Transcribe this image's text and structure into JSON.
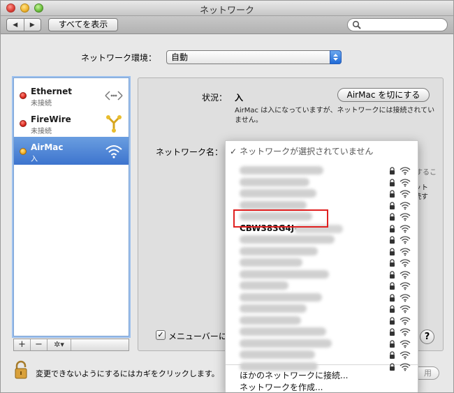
{
  "window": {
    "title": "ネットワーク"
  },
  "toolbar": {
    "back_glyph": "◀",
    "forward_glyph": "▶",
    "show_all_label": "すべてを表示",
    "search_placeholder": ""
  },
  "location": {
    "label": "ネットワーク環境：",
    "value": "自動"
  },
  "services": [
    {
      "name": "Ethernet",
      "status": "未接続",
      "status_color": "red",
      "icon": "ethernet-icon",
      "selected": false
    },
    {
      "name": "FireWire",
      "status": "未接続",
      "status_color": "red",
      "icon": "firewire-icon",
      "selected": false
    },
    {
      "name": "AirMac",
      "status": "入",
      "status_color": "yellow",
      "icon": "wifi-icon",
      "selected": true
    }
  ],
  "list_toolbar": {
    "add": "+",
    "remove": "−",
    "gear": "✲▾"
  },
  "detail": {
    "status_label": "状況：",
    "status_value": "入",
    "turn_off_button": "AirMac を切にする",
    "status_description": "AirMac は入になっていますが、ネットワークには接続されていません。",
    "network_name_label": "ネットワーク名：",
    "edge_text_1": "ット",
    "edge_text_2": "続す",
    "edge_text_3": "するこ",
    "show_in_menubar_label": "メニューバーに",
    "help_label": "?"
  },
  "network_menu": {
    "header": "ネットワークが選択されていません",
    "header_check": "✓",
    "networks_blurred_count": 17,
    "highlighted_network": "CBW383G4J-",
    "other_network_action": "ほかのネットワークに接続...",
    "create_network_action": "ネットワークを作成..."
  },
  "footer": {
    "lock_text": "変更できないようにするにはカギをクリックします。",
    "apply_button": "用"
  },
  "colors": {
    "selection_blue": "#3d74ce",
    "highlight_red": "#e02020",
    "status_red": "#d9261c",
    "status_yellow": "#f0aa21"
  }
}
